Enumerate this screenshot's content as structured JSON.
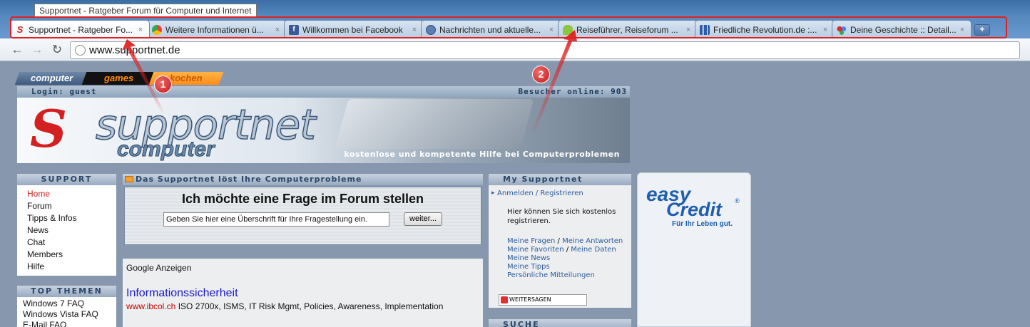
{
  "browser": {
    "tooltip": "Supportnet - Ratgeber Forum für Computer und Internet",
    "tabs": [
      {
        "label": "Supportnet - Ratgeber Fo...",
        "icon": "supportnet-favicon",
        "color": "#d42020"
      },
      {
        "label": "Weitere Informationen ü...",
        "icon": "chrome-favicon",
        "color": "#34a853"
      },
      {
        "label": "Willkommen bei Facebook",
        "icon": "facebook-favicon",
        "color": "#3b5998"
      },
      {
        "label": "Nachrichten und aktuelle...",
        "icon": "globe-favicon",
        "color": "#5a7fb0"
      },
      {
        "label": "Reiseführer, Reiseforum ...",
        "icon": "android-favicon",
        "color": "#8cc63f"
      },
      {
        "label": "Friedliche Revolution.de :...",
        "icon": "chart-favicon",
        "color": "#2a5ca8"
      },
      {
        "label": "Deine Geschichte :: Detail...",
        "icon": "dots-favicon",
        "color": "#d93025"
      }
    ],
    "close_glyph": "×",
    "newtab_glyph": "+",
    "url": "www.supportnet.de"
  },
  "site": {
    "nav_tabs": [
      "computer",
      "games",
      "kochen"
    ],
    "login": "Login: guest",
    "visitors": "Besucher online: 903",
    "banner_brand": "supportnet",
    "banner_sub": "computer",
    "banner_tagline": "kostenlose und kompetente Hilfe bei Computerproblemen",
    "support": {
      "title": "SUPPORT",
      "items": [
        "Home",
        "Forum",
        "Tipps & Infos",
        "News",
        "Chat",
        "Members",
        "Hilfe"
      ]
    },
    "top_themen": {
      "title": "TOP THEMEN",
      "items": [
        "Windows 7 FAQ",
        "Windows Vista FAQ",
        "E-Mail FAQ"
      ]
    },
    "center": {
      "title": "Das Supportnet löst Ihre Computerprobleme",
      "ask_heading": "Ich möchte eine Frage im Forum stellen",
      "ask_input": "Geben Sie hier eine Überschrift für Ihre Fragestellung ein.",
      "ask_button": "weiter...",
      "ads_title": "Google Anzeigen",
      "ad_link": "Informationssicherheit",
      "ad_domain": "www.ibcol.ch",
      "ad_text": " ISO 2700x, ISMS, IT Risk Mgmt, Policies, Awareness, Implementation"
    },
    "my_supportnet": {
      "title": "My Supportnet",
      "signup_link": "Anmelden / Registrieren",
      "info": "Hier können Sie sich kostenlos registrieren.",
      "links": [
        "Meine Fragen",
        "Meine Antworten",
        "Meine Favoriten",
        "Meine Daten",
        "Meine News",
        "Meine Tipps",
        "Persönliche Mitteilungen"
      ],
      "share": "WEITERSAGEN"
    },
    "suche_title": "SUCHE",
    "ad": {
      "logo_line1": "easy",
      "logo_line2": "Credit",
      "reg": "®",
      "slogan": "Für Ihr Leben gut."
    }
  },
  "annotations": [
    "1",
    "2"
  ],
  "colors": {
    "annotation_red": "#e02020",
    "brand_red": "#d42020",
    "link_blue": "#2f5c9c"
  }
}
